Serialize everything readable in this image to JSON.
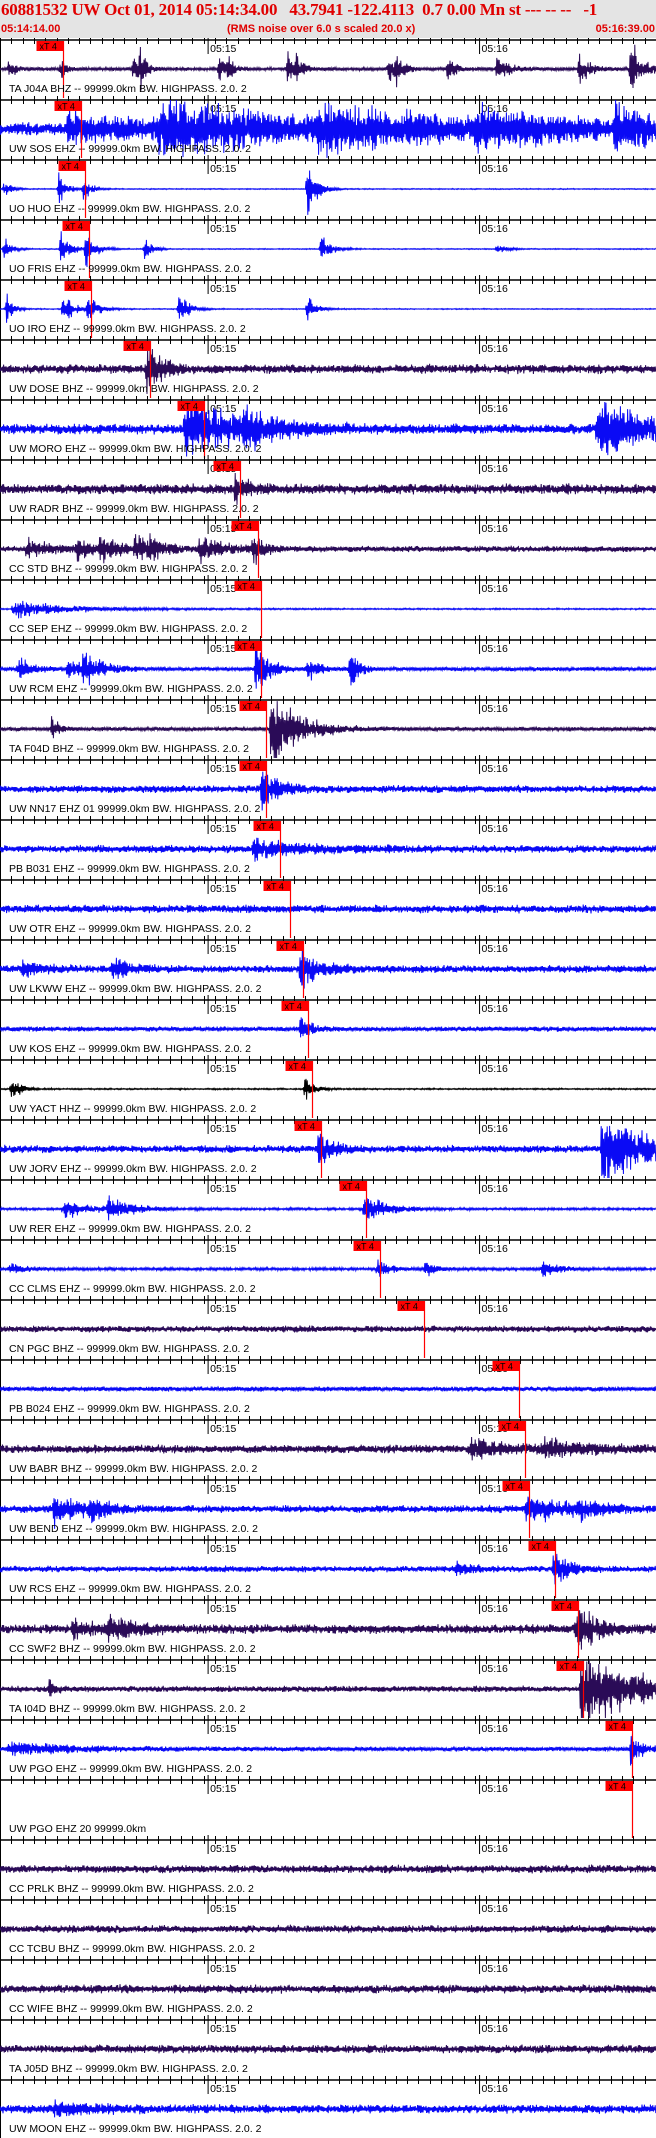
{
  "header": {
    "title": "60881532 UW Oct 01, 2014 05:14:34.00   43.7941 -122.4113  0.7 0.00 Mn st --- -- --   -1",
    "start_time": "05:14:14.00",
    "note": "(RMS noise over 6.0 s scaled 20.0 x)",
    "end_time": "05:16:39.00"
  },
  "colors": {
    "header_text": "#e00000",
    "header_bg": "#e4e4e4",
    "purple": "#2a0b57",
    "blue": "#0a0af5",
    "black": "#000000",
    "pick": "#ff0000"
  },
  "chart_data": {
    "type": "line",
    "title": "60881532 UW Oct 01, 2014 05:14:34.00",
    "x_range_seconds": [
      0,
      145
    ],
    "x_start": "05:14:14",
    "x_end": "05:16:39",
    "tick_labels": [
      {
        "t": 46,
        "label": "05:15"
      },
      {
        "t": 106,
        "label": "05:16"
      }
    ],
    "pick_label": "xT 4",
    "traces": [
      {
        "label": "TA J04A BHZ -- 99999.0km BW. HIGHPASS. 2.0. 2",
        "color": "purple",
        "noise": 0.07,
        "pick": 13.9,
        "events": [
          [
            2,
            0.5,
            1
          ],
          [
            13.5,
            0.5,
            1
          ],
          [
            29.5,
            0.6,
            1.5
          ],
          [
            31,
            0.9,
            1
          ],
          [
            48.5,
            0.5,
            1
          ],
          [
            50.5,
            0.6,
            1
          ],
          [
            63.6,
            0.8,
            1
          ],
          [
            65.5,
            0.5,
            1.5
          ],
          [
            86,
            0.5,
            1.5
          ],
          [
            87.5,
            0.5,
            1.5
          ],
          [
            99,
            0.5,
            1.5
          ],
          [
            110,
            0.6,
            2
          ],
          [
            128,
            0.6,
            2
          ],
          [
            139.5,
            1.1,
            2
          ]
        ]
      },
      {
        "label": "UW SOS EHZ -- 99999.0km BW. HIGHPASS. 2.0. 2",
        "color": "blue",
        "noise": 0.25,
        "pick": 17.9,
        "events": [
          [
            15,
            0.5,
            20
          ],
          [
            35,
            0.8,
            30
          ],
          [
            70,
            0.6,
            30
          ],
          [
            105,
            0.5,
            20
          ],
          [
            136,
            0.9,
            6
          ]
        ]
      },
      {
        "label": "UO HUO EHZ -- 99999.0km BW. HIGHPASS. 2.0. 2",
        "color": "blue",
        "noise": 0.02,
        "pick": 18.8,
        "events": [
          [
            1,
            0.3,
            1.5
          ],
          [
            13,
            0.6,
            1.5
          ],
          [
            18.5,
            0.5,
            1.5
          ],
          [
            68,
            0.9,
            1.5
          ],
          [
            70,
            0.4,
            1.5
          ]
        ]
      },
      {
        "label": "UO FRIS EHZ -- 99999.0km BW. HIGHPASS. 2.0. 2",
        "color": "blue",
        "noise": 0.02,
        "pick": 19.6,
        "events": [
          [
            1,
            0.5,
            1.5
          ],
          [
            13.5,
            0.6,
            2
          ],
          [
            19,
            0.6,
            2
          ],
          [
            32,
            0.4,
            1.5
          ],
          [
            71,
            0.5,
            2
          ],
          [
            110,
            0.2,
            2
          ]
        ]
      },
      {
        "label": "UO IRO EHZ -- 99999.0km BW. HIGHPASS. 2.0. 2",
        "color": "blue",
        "noise": 0.02,
        "pick": 20.1,
        "events": [
          [
            1.5,
            0.5,
            1.5
          ],
          [
            14,
            0.6,
            2
          ],
          [
            19.3,
            0.5,
            2
          ],
          [
            39.5,
            0.6,
            2
          ],
          [
            68,
            0.4,
            2
          ]
        ]
      },
      {
        "label": "UW DOSE BHZ -- 99999.0km BW. HIGHPASS. 2.0. 2",
        "color": "purple",
        "noise": 0.18,
        "pick": 33.1,
        "events": [
          [
            32.5,
            0.9,
            3
          ]
        ]
      },
      {
        "label": "UW MORO EHZ -- 99999.0km BW. HIGHPASS. 2.0. 2",
        "color": "blue",
        "noise": 0.2,
        "pick": 45.0,
        "events": [
          [
            41,
            1.2,
            10
          ],
          [
            54,
            0.6,
            6
          ],
          [
            132,
            0.9,
            12
          ]
        ]
      },
      {
        "label": "UW RADR BHZ -- 99999.0km BW. HIGHPASS. 2.0. 2",
        "color": "purple",
        "noise": 0.2,
        "pick": 53.0,
        "events": [
          [
            52,
            0.5,
            3
          ]
        ]
      },
      {
        "label": "CC STD BHZ -- 99999.0km BW. HIGHPASS. 2.0. 2",
        "color": "purple",
        "noise": 0.12,
        "pick": 57.0,
        "events": [
          [
            6,
            0.4,
            4
          ],
          [
            17,
            0.4,
            3
          ],
          [
            22,
            0.5,
            4
          ],
          [
            30,
            0.5,
            3
          ],
          [
            33,
            0.4,
            3
          ],
          [
            44,
            0.4,
            5
          ],
          [
            56,
            0.6,
            2
          ]
        ]
      },
      {
        "label": "CC SEP EHZ -- 99999.0km BW. HIGHPASS. 2.0. 2",
        "color": "blue",
        "noise": 0.03,
        "pick": 57.8,
        "events": [
          [
            3,
            0.3,
            12
          ]
        ]
      },
      {
        "label": "UW RCM EHZ -- 99999.0km BW. HIGHPASS. 2.0. 2",
        "color": "blue",
        "noise": 0.08,
        "pick": 57.8,
        "events": [
          [
            4,
            0.4,
            3
          ],
          [
            15,
            0.4,
            3
          ],
          [
            18.5,
            0.5,
            4
          ],
          [
            56.5,
            0.9,
            3
          ],
          [
            68,
            0.5,
            2
          ],
          [
            77.5,
            1.0,
            1.5
          ]
        ]
      },
      {
        "label": "TA F04D BHZ -- 99999.0km BW. HIGHPASS. 2.0. 2",
        "color": "purple",
        "noise": 0.08,
        "pick": 58.9,
        "events": [
          [
            11.5,
            0.4,
            1.5
          ],
          [
            60,
            1.3,
            6
          ]
        ]
      },
      {
        "label": "UW NN17 EHZ 01 99999.0km BW. HIGHPASS. 2.0. 2",
        "color": "blue",
        "noise": 0.15,
        "pick": 58.9,
        "events": [
          [
            58,
            0.9,
            3
          ]
        ]
      },
      {
        "label": "PB B031 EHZ -- 99999.0km BW. HIGHPASS. 2.0. 2",
        "color": "blue",
        "noise": 0.15,
        "pick": 61.8,
        "events": [
          [
            56,
            0.3,
            10
          ]
        ]
      },
      {
        "label": "UW OTR EHZ -- 99999.0km BW. HIGHPASS. 2.0. 2",
        "color": "blue",
        "noise": 0.16,
        "pick": 64.0,
        "events": []
      },
      {
        "label": "UW LKWW EHZ -- 99999.0km BW. HIGHPASS. 2.0. 2",
        "color": "blue",
        "noise": 0.15,
        "pick": 66.9,
        "events": [
          [
            5,
            0.3,
            4
          ],
          [
            25,
            0.4,
            4
          ],
          [
            66.5,
            0.6,
            4
          ]
        ]
      },
      {
        "label": "UW KOS EHZ -- 99999.0km BW. HIGHPASS. 2.0. 2",
        "color": "blue",
        "noise": 0.1,
        "pick": 68.0,
        "events": [
          [
            66.5,
            0.5,
            2
          ]
        ]
      },
      {
        "label": "UW YACT HHZ -- 99999.0km BW. HIGHPASS. 2.0. 2",
        "color": "black",
        "noise": 0.03,
        "pick": 68.9,
        "events": [
          [
            2.5,
            0.4,
            2
          ],
          [
            67.5,
            0.4,
            2
          ]
        ]
      },
      {
        "label": "UW JORV EHZ -- 99999.0km BW. HIGHPASS. 2.0. 2",
        "color": "blue",
        "noise": 0.15,
        "pick": 70.9,
        "events": [
          [
            70.5,
            0.6,
            3
          ],
          [
            133,
            1.2,
            10
          ]
        ]
      },
      {
        "label": "UW RER EHZ -- 99999.0km BW. HIGHPASS. 2.0. 2",
        "color": "blue",
        "noise": 0.05,
        "pick": 80.8,
        "events": [
          [
            14,
            0.3,
            6
          ],
          [
            24,
            0.4,
            5
          ],
          [
            80.5,
            0.5,
            5
          ]
        ]
      },
      {
        "label": "CC CLMS EHZ -- 99999.0km BW. HIGHPASS. 2.0. 2",
        "color": "blue",
        "noise": 0.06,
        "pick": 83.9,
        "events": [
          [
            2,
            0.2,
            3
          ],
          [
            83.5,
            0.3,
            3
          ],
          [
            94,
            0.3,
            2
          ],
          [
            120,
            0.3,
            3
          ]
        ]
      },
      {
        "label": "CN PGC BHZ -- 99999.0km BW. HIGHPASS. 2.0. 2",
        "color": "purple",
        "noise": 0.13,
        "pick": 93.8,
        "events": []
      },
      {
        "label": "PB B024 EHZ -- 99999.0km BW. HIGHPASS. 2.0. 2",
        "color": "blue",
        "noise": 0.1,
        "pick": 114.8,
        "events": []
      },
      {
        "label": "UW BABR BHZ -- 99999.0km BW. HIGHPASS. 2.0. 2",
        "color": "purple",
        "noise": 0.17,
        "pick": 116.1,
        "events": [
          [
            104,
            0.3,
            8
          ],
          [
            120,
            0.3,
            8
          ]
        ]
      },
      {
        "label": "UW BEND EHZ -- 99999.0km BW. HIGHPASS. 2.0. 2",
        "color": "blue",
        "noise": 0.15,
        "pick": 117.0,
        "events": [
          [
            12,
            0.6,
            5
          ],
          [
            20,
            0.4,
            3
          ],
          [
            116.5,
            0.4,
            10
          ],
          [
            128,
            0.3,
            3
          ]
        ]
      },
      {
        "label": "UW RCS EHZ -- 99999.0km BW. HIGHPASS. 2.0. 2",
        "color": "blue",
        "noise": 0.12,
        "pick": 122.7,
        "events": [
          [
            101,
            0.2,
            4
          ],
          [
            122.5,
            0.7,
            3
          ]
        ]
      },
      {
        "label": "CC SWF2 BHZ -- 99999.0km BW. HIGHPASS. 2.0. 2",
        "color": "purple",
        "noise": 0.18,
        "pick": 127.8,
        "events": [
          [
            16,
            0.3,
            5
          ],
          [
            24,
            0.4,
            6
          ],
          [
            127.5,
            0.7,
            5
          ]
        ]
      },
      {
        "label": "TA I04D BHZ -- 99999.0km BW. HIGHPASS. 2.0. 2",
        "color": "purple",
        "noise": 0.12,
        "pick": 128.9,
        "events": [
          [
            11,
            0.5,
            1
          ],
          [
            128.5,
            1.6,
            10
          ]
        ]
      },
      {
        "label": "UW PGO EHZ -- 99999.0km BW. HIGHPASS. 2.0. 2",
        "color": "blue",
        "noise": 0.09,
        "pick": 139.7,
        "events": [
          [
            2,
            0.2,
            15
          ],
          [
            139.5,
            0.6,
            2
          ]
        ]
      },
      {
        "label": "UW PGO EHZ 20 99999.0km",
        "color": "none",
        "noise": 0,
        "pick": 139.7,
        "events": []
      },
      {
        "label": "CC PRLK BHZ -- 99999.0km BW. HIGHPASS. 2.0. 2",
        "color": "purple",
        "noise": 0.16,
        "pick": null,
        "events": []
      },
      {
        "label": "CC TCBU BHZ -- 99999.0km BW. HIGHPASS. 2.0. 2",
        "color": "purple",
        "noise": 0.15,
        "pick": null,
        "events": []
      },
      {
        "label": "CC WIFE BHZ -- 99999.0km BW. HIGHPASS. 2.0. 2",
        "color": "purple",
        "noise": 0.17,
        "pick": null,
        "events": []
      },
      {
        "label": "TA J05D BHZ -- 99999.0km BW. HIGHPASS. 2.0. 2",
        "color": "purple",
        "noise": 0.16,
        "pick": null,
        "events": []
      },
      {
        "label": "UW MOON EHZ -- 99999.0km BW. HIGHPASS. 2.0. 2",
        "color": "blue",
        "noise": 0.17,
        "pick": null,
        "events": [
          [
            12,
            0.2,
            10
          ]
        ]
      }
    ]
  }
}
